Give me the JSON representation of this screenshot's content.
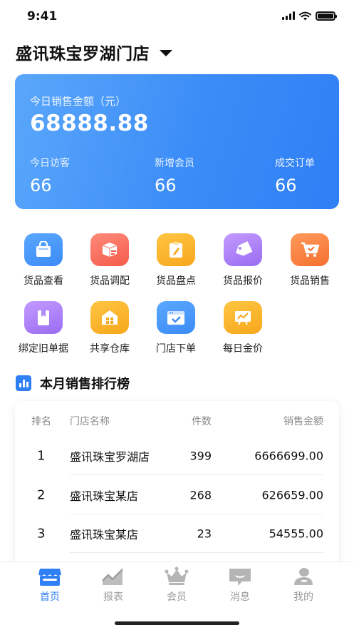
{
  "status_bar": {
    "time": "9:41"
  },
  "header": {
    "store_name": "盛讯珠宝罗湖门店"
  },
  "sales_card": {
    "label": "今日销售金额（元）",
    "amount": "68888.88",
    "stats": [
      {
        "label": "今日访客",
        "value": "66"
      },
      {
        "label": "新增会员",
        "value": "66"
      },
      {
        "label": "成交订单",
        "value": "66"
      }
    ]
  },
  "functions": [
    {
      "label": "货品查看",
      "icon": "shopping-bag-icon",
      "color": "#3b8bf6"
    },
    {
      "label": "货品调配",
      "icon": "box-transfer-icon",
      "color": "#f45b4a"
    },
    {
      "label": "货品盘点",
      "icon": "clipboard-edit-icon",
      "color": "#f7a71c"
    },
    {
      "label": "货品报价",
      "icon": "price-tag-icon",
      "color": "#9a6cf2"
    },
    {
      "label": "货品销售",
      "icon": "shopping-cart-icon",
      "color": "#f5702e"
    },
    {
      "label": "绑定旧单据",
      "icon": "document-bookmark-icon",
      "color": "#9a6cf2"
    },
    {
      "label": "共享仓库",
      "icon": "warehouse-icon",
      "color": "#f7a71c"
    },
    {
      "label": "门店下单",
      "icon": "browser-check-icon",
      "color": "#3b8bf6"
    },
    {
      "label": "每日金价",
      "icon": "trend-board-icon",
      "color": "#f7a71c"
    }
  ],
  "ranking": {
    "title": "本月销售排行榜",
    "columns": [
      "排名",
      "门店名称",
      "件数",
      "销售金额"
    ],
    "rows": [
      {
        "rank": "1",
        "name": "盛讯珠宝罗湖店",
        "qty": "399",
        "amount": "6666699.00"
      },
      {
        "rank": "2",
        "name": "盛讯珠宝某店",
        "qty": "268",
        "amount": "626659.00"
      },
      {
        "rank": "3",
        "name": "盛讯珠宝某店",
        "qty": "23",
        "amount": "54555.00"
      }
    ]
  },
  "tabs": [
    {
      "label": "首页",
      "icon": "home-store-icon",
      "active": true
    },
    {
      "label": "报表",
      "icon": "chart-icon",
      "active": false
    },
    {
      "label": "会员",
      "icon": "crown-icon",
      "active": false
    },
    {
      "label": "消息",
      "icon": "message-icon",
      "active": false
    },
    {
      "label": "我的",
      "icon": "user-icon",
      "active": false
    }
  ],
  "colors": {
    "accent": "#2f7ff5",
    "tab_inactive": "#9a9a9a"
  }
}
